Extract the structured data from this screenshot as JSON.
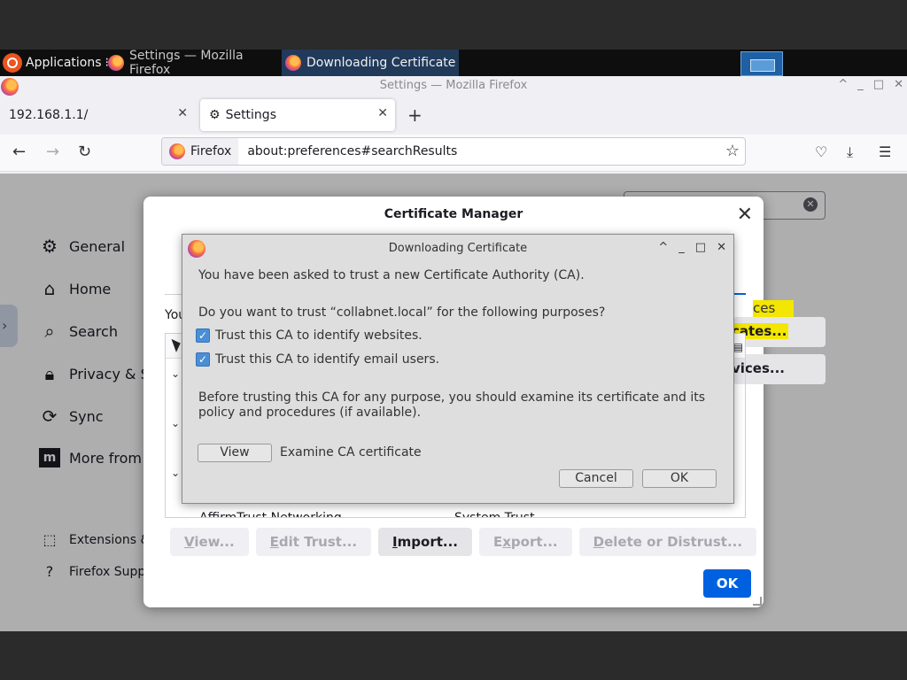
{
  "taskbar": {
    "apps_label": "Applications",
    "apps_sep": "⁝",
    "tasks": [
      {
        "label": "Settings — Mozilla Firefox"
      },
      {
        "label": "Downloading Certificate"
      }
    ]
  },
  "window": {
    "title": "Settings — Mozilla Firefox",
    "controls": [
      "^",
      "_",
      "□",
      "✕"
    ]
  },
  "tabs": [
    {
      "label": "192.168.1.1/"
    },
    {
      "label": "Settings"
    }
  ],
  "toolbar": {
    "url_identity": "Firefox",
    "url": "about:preferences#searchResults"
  },
  "sidebar": {
    "items": [
      {
        "label": "General"
      },
      {
        "label": "Home"
      },
      {
        "label": "Search"
      },
      {
        "label": "Privacy & S"
      },
      {
        "label": "Sync"
      },
      {
        "label": "More from"
      }
    ],
    "footer": [
      {
        "label": "Extensions &"
      },
      {
        "label": "Firefox Suppo"
      }
    ]
  },
  "cert_manager": {
    "title": "Certificate Manager",
    "partial_text": "You",
    "hl_text": "ces",
    "side_buttons": [
      "cates...",
      "vices..."
    ],
    "tree_partial": {
      "left": "AffirmTrust Networking",
      "right": "System Trust"
    },
    "actions": [
      {
        "pre": "",
        "u": "V",
        "post": "iew...",
        "enabled": false
      },
      {
        "pre": "",
        "u": "E",
        "post": "dit Trust...",
        "enabled": false
      },
      {
        "pre": "",
        "u": "I",
        "post": "mport...",
        "enabled": true
      },
      {
        "pre": "E",
        "u": "x",
        "post": "port...",
        "enabled": false
      },
      {
        "pre": "",
        "u": "D",
        "post": "elete or Distrust...",
        "enabled": false
      }
    ],
    "ok_label": "OK"
  },
  "download_dialog": {
    "title": "Downloading Certificate",
    "intro": "You have been asked to trust a new Certificate Authority (CA).",
    "question": "Do you want to trust “collabnet.local” for the following purposes?",
    "checkboxes": [
      {
        "label": "Trust this CA to identify websites.",
        "checked": true
      },
      {
        "label": "Trust this CA to identify email users.",
        "checked": true
      }
    ],
    "advice": "Before trusting this CA for any purpose, you should examine its certificate and its policy and procedures (if available).",
    "view_label": "View",
    "view_caption": "Examine CA certificate",
    "cancel_label": "Cancel",
    "ok_label": "OK"
  },
  "colors": {
    "accent": "#0061e0",
    "highlight": "#f3e600",
    "checkbox": "#4a8fd6"
  }
}
